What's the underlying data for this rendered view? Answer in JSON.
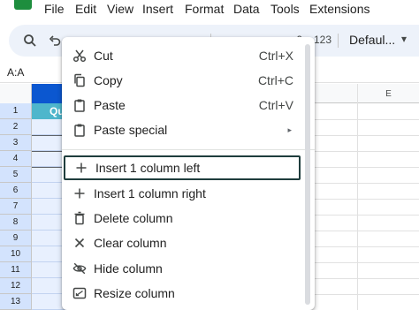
{
  "menubar": {
    "items": [
      "File",
      "Edit",
      "View",
      "Insert",
      "Format",
      "Data",
      "Tools",
      "Extensions"
    ]
  },
  "toolbar": {
    "font_size_value": "123",
    "font_family": "Defaul..."
  },
  "formula_bar": {
    "name_box": "A:A"
  },
  "grid": {
    "column_e_label": "E",
    "cell_a1_text": "Qu",
    "row_numbers": [
      "1",
      "2",
      "3",
      "4",
      "5",
      "6",
      "7",
      "8",
      "9",
      "10",
      "11",
      "12",
      "13"
    ]
  },
  "context_menu": {
    "items": [
      {
        "label": "Cut",
        "shortcut": "Ctrl+X",
        "icon": "scissors-icon"
      },
      {
        "label": "Copy",
        "shortcut": "Ctrl+C",
        "icon": "copy-icon"
      },
      {
        "label": "Paste",
        "shortcut": "Ctrl+V",
        "icon": "clipboard-icon"
      },
      {
        "label": "Paste special",
        "shortcut": "▸",
        "icon": "clipboard-icon"
      },
      {
        "label": "Insert 1 column left",
        "shortcut": "",
        "icon": "plus-icon"
      },
      {
        "label": "Insert 1 column right",
        "shortcut": "",
        "icon": "plus-icon"
      },
      {
        "label": "Delete column",
        "shortcut": "",
        "icon": "trash-icon"
      },
      {
        "label": "Clear column",
        "shortcut": "",
        "icon": "x-icon"
      },
      {
        "label": "Hide column",
        "shortcut": "",
        "icon": "eye-off-icon"
      },
      {
        "label": "Resize column",
        "shortcut": "",
        "icon": "resize-icon"
      }
    ]
  }
}
